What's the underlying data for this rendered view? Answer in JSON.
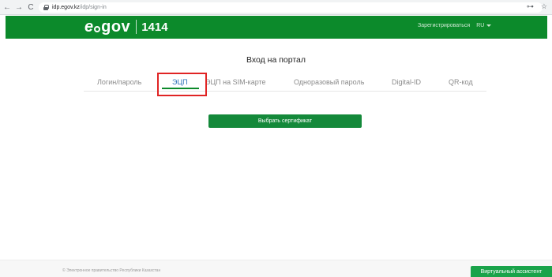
{
  "browser": {
    "back_icon": "←",
    "forward_icon": "→",
    "reload_icon": "C",
    "url_host": "idp.egov.kz",
    "url_path": "/idp/sign-in",
    "key_icon": "⊶",
    "star_icon": "☆"
  },
  "header": {
    "logo_e": "e",
    "logo_gov": "gov",
    "logo_number": "1414",
    "register_link": "Зарегистрироваться",
    "language": "RU",
    "color": "#0c8a2b"
  },
  "main": {
    "title": "Вход на портал",
    "tabs": [
      {
        "label": "Логин/пароль",
        "active": false
      },
      {
        "label": "ЭЦП",
        "active": true
      },
      {
        "label": "ЭЦП на SIM-карте",
        "active": false
      },
      {
        "label": "Одноразовый пароль",
        "active": false
      },
      {
        "label": "Digital-ID",
        "active": false
      },
      {
        "label": "QR-код",
        "active": false
      }
    ],
    "select_certificate_button": "Выбрать сертификат"
  },
  "footer": {
    "copyright": "© Электронное правительство Республики Казахстан",
    "assistant_button": "Виртуальный ассистент"
  }
}
